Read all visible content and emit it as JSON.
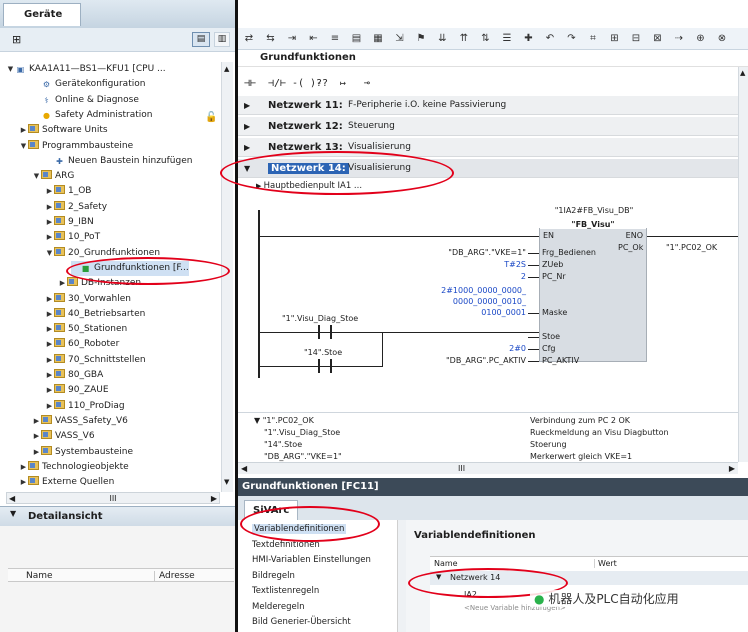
{
  "devices": {
    "tab": "Geräte",
    "detail": "Detailansicht",
    "detail_cols": [
      "Name",
      "Adresse"
    ]
  },
  "tree": [
    {
      "label": "KAA1A11—BS1—KFU1 [CPU ...",
      "indent": 0,
      "tri": "▼",
      "icon": "cpu-icon"
    },
    {
      "label": "Gerätekonfiguration",
      "indent": 2,
      "tri": "",
      "icon": "device-config-icon"
    },
    {
      "label": "Online & Diagnose",
      "indent": 2,
      "tri": "",
      "icon": "online-diagnose-icon"
    },
    {
      "label": "Safety Administration",
      "indent": 2,
      "tri": "",
      "icon": "safety-icon"
    },
    {
      "label": "Software Units",
      "indent": 1,
      "tri": "▶",
      "icon": "folder-icon"
    },
    {
      "label": "Programmbausteine",
      "indent": 1,
      "tri": "▼",
      "icon": "folder-icon"
    },
    {
      "label": "Neuen Baustein hinzufügen",
      "indent": 3,
      "tri": "",
      "icon": "add-block-icon"
    },
    {
      "label": "ARG",
      "indent": 2,
      "tri": "▼",
      "icon": "folder-icon"
    },
    {
      "label": "1_OB",
      "indent": 3,
      "tri": "▶",
      "icon": "folder-icon"
    },
    {
      "label": "2_Safety",
      "indent": 3,
      "tri": "▶",
      "icon": "folder-icon"
    },
    {
      "label": "9_IBN",
      "indent": 3,
      "tri": "▶",
      "icon": "folder-icon"
    },
    {
      "label": "10_PoT",
      "indent": 3,
      "tri": "▶",
      "icon": "folder-icon"
    },
    {
      "label": "20_Grundfunktionen",
      "indent": 3,
      "tri": "▼",
      "icon": "folder-icon"
    },
    {
      "label": "Grundfunktionen [F...",
      "indent": 5,
      "tri": "",
      "icon": "fc-block-icon",
      "selected": true
    },
    {
      "label": "DB-Instanzen",
      "indent": 4,
      "tri": "▶",
      "icon": "folder-icon"
    },
    {
      "label": "30_Vorwahlen",
      "indent": 3,
      "tri": "▶",
      "icon": "folder-icon"
    },
    {
      "label": "40_Betriebsarten",
      "indent": 3,
      "tri": "▶",
      "icon": "folder-icon"
    },
    {
      "label": "50_Stationen",
      "indent": 3,
      "tri": "▶",
      "icon": "folder-icon"
    },
    {
      "label": "60_Roboter",
      "indent": 3,
      "tri": "▶",
      "icon": "folder-icon"
    },
    {
      "label": "70_Schnittstellen",
      "indent": 3,
      "tri": "▶",
      "icon": "folder-icon"
    },
    {
      "label": "80_GBA",
      "indent": 3,
      "tri": "▶",
      "icon": "folder-icon"
    },
    {
      "label": "90_ZAUE",
      "indent": 3,
      "tri": "▶",
      "icon": "folder-icon"
    },
    {
      "label": "110_ProDiag",
      "indent": 3,
      "tri": "▶",
      "icon": "folder-icon"
    },
    {
      "label": "VASS_Safety_V6",
      "indent": 2,
      "tri": "▶",
      "icon": "folder-icon"
    },
    {
      "label": "VASS_V6",
      "indent": 2,
      "tri": "▶",
      "icon": "folder-icon"
    },
    {
      "label": "Systembausteine",
      "indent": 2,
      "tri": "▶",
      "icon": "folder-icon"
    },
    {
      "label": "Technologieobjekte",
      "indent": 1,
      "tri": "▶",
      "icon": "folder-icon"
    },
    {
      "label": "Externe Quellen",
      "indent": 1,
      "tri": "▶",
      "icon": "folder-icon"
    }
  ],
  "editor": {
    "block_title": "Grundfunktionen",
    "networks": [
      {
        "name": "Netzwerk 11:",
        "desc": "F-Peripherie i.O. keine Passivierung"
      },
      {
        "name": "Netzwerk 12:",
        "desc": "Steuerung"
      },
      {
        "name": "Netzwerk 13:",
        "desc": "Visualisierung"
      }
    ],
    "active_network": {
      "name": "Netzwerk 14:",
      "desc": "Visualisierung"
    },
    "subtitle": "Hauptbedienpult IA1 ...",
    "ladder_buttons": [
      "⊣⊢",
      "⊣/⊢",
      "-( )-",
      "??",
      "↦",
      "⊸"
    ]
  },
  "fb": {
    "instance": "\"1IA2#FB_Visu_DB\"",
    "type": "\"FB_Visu\"",
    "en": "EN",
    "eno": "ENO",
    "inputs": [
      {
        "pin": "Frg_Bedienen",
        "value": "\"DB_ARG\".\"VKE=1\"",
        "blue": false
      },
      {
        "pin": "ZUeb",
        "value": "T#2S",
        "blue": true
      },
      {
        "pin": "PC_Nr",
        "value": "2",
        "blue": true
      },
      {
        "pin": "Maske",
        "value": "2#1000_0000_0000_\n0000_0000_0010_\n0100_0001",
        "blue": true
      },
      {
        "pin": "Stoe",
        "value": "",
        "blue": false
      },
      {
        "pin": "Cfg",
        "value": "2#0",
        "blue": true
      },
      {
        "pin": "PC_AKTIV",
        "value": "\"DB_ARG\".PC_AKTIV",
        "blue": false
      }
    ],
    "outputs": [
      {
        "pin": "PC_Ok",
        "value": "\"1\".PC02_OK"
      }
    ],
    "contacts": [
      "\"1\".Visu_Diag_Stoe",
      "\"14\".Stoe"
    ]
  },
  "tags": [
    {
      "name": "\"1\".PC02_OK",
      "comment": "Verbindung zum PC 2 OK"
    },
    {
      "name": "\"1\".Visu_Diag_Stoe",
      "comment": "Rueckmeldung an Visu  Diagbutton"
    },
    {
      "name": "\"14\".Stoe",
      "comment": "Stoerung"
    },
    {
      "name": "\"DB_ARG\".\"VKE=1\"",
      "comment": "Merkerwert gleich VKE=1"
    }
  ],
  "inspector": {
    "title": "Grundfunktionen [FC11]",
    "tab": "SiVArc",
    "menu": [
      "Variablendefinitionen",
      "Textdefinitionen",
      "HMI-Variablen Einstellungen",
      "Bildregeln",
      "Textlistenregeln",
      "Melderegeln",
      "Bild Generier-Übersicht"
    ],
    "section_title": "Variablendefinitionen",
    "grid_cols": [
      "Name",
      "Wert"
    ],
    "group": "Netzwerk 14",
    "row": "IA2",
    "add_placeholder": "<Neue Variable hinzufügen>"
  },
  "watermark": "机器人及PLC自动化应用"
}
